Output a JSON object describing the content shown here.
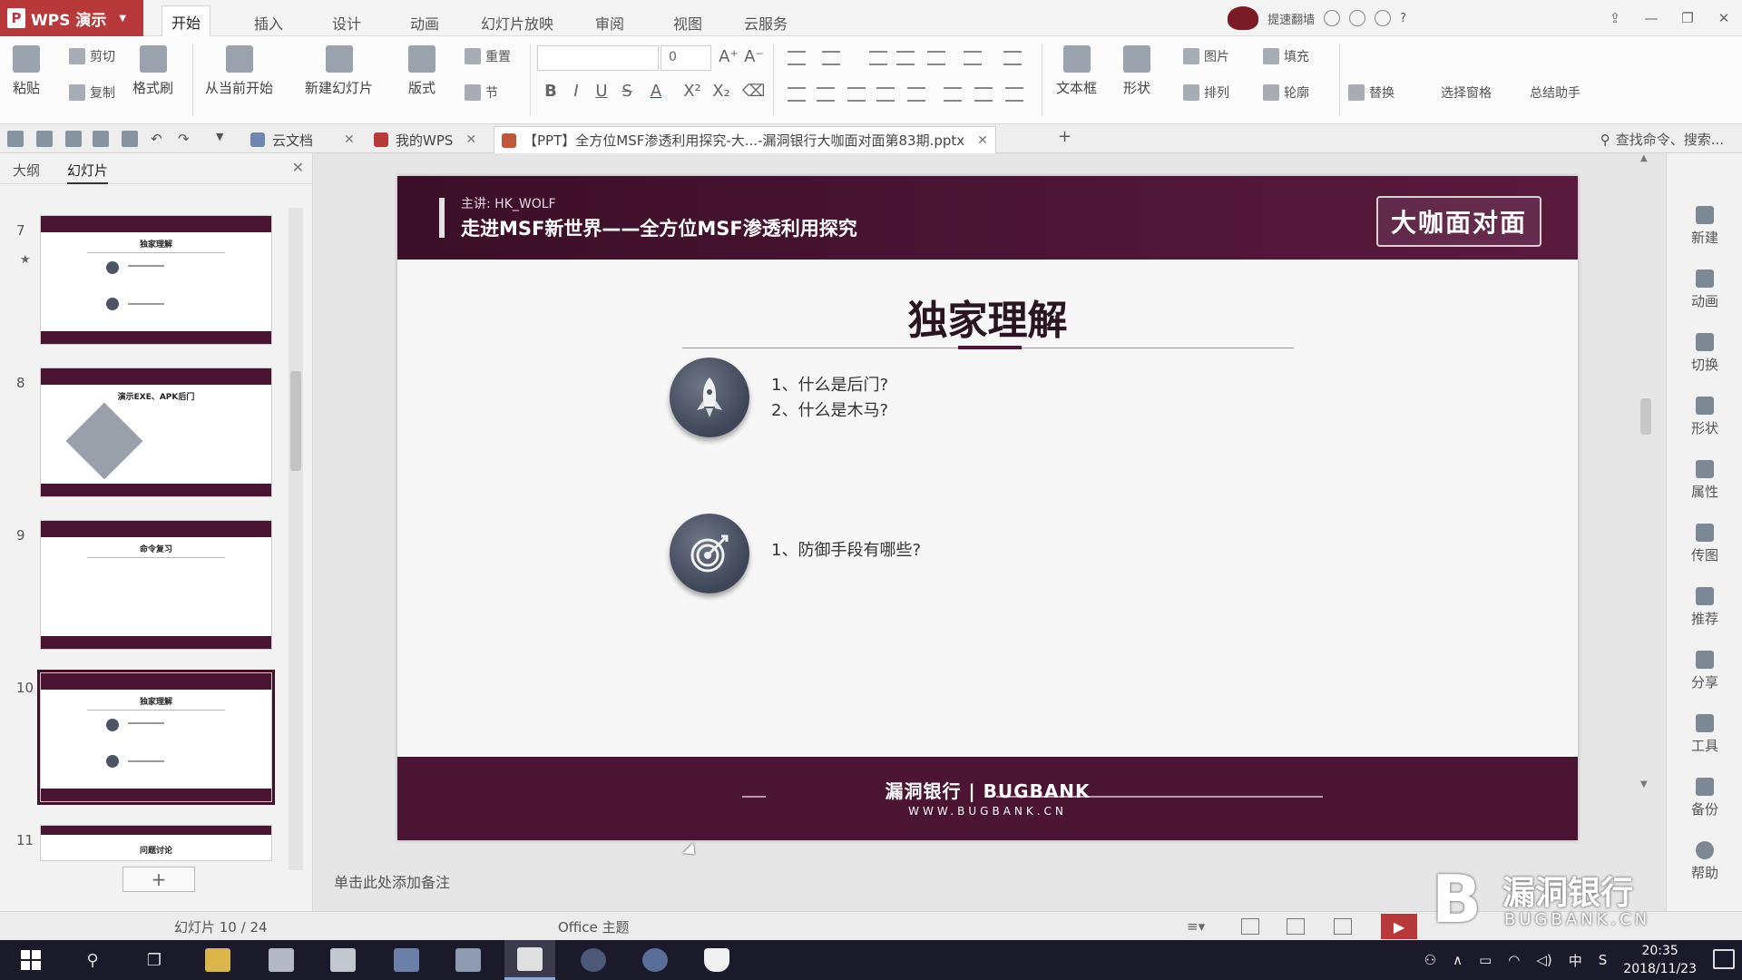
{
  "app": {
    "name": "WPS 演示",
    "menu_tabs": [
      "开始",
      "插入",
      "设计",
      "动画",
      "幻灯片放映",
      "审阅",
      "视图",
      "云服务"
    ],
    "active_tab": "开始",
    "user_label": "提速翻墙",
    "window_controls": [
      "minimize",
      "restore",
      "close"
    ]
  },
  "ribbon": {
    "paste": "粘贴",
    "cut": "剪切",
    "copy": "复制",
    "format_painter": "格式刷",
    "from_current": "从当前开始",
    "new_slide": "新建幻灯片",
    "layout": "版式",
    "reset": "重置",
    "section": "节",
    "font_size": "0",
    "bold": "B",
    "italic": "I",
    "underline": "U",
    "strike": "S",
    "font_color": "A",
    "superscript": "X²",
    "subscript": "X₂",
    "text_box": "文本框",
    "shape": "形状",
    "picture": "图片",
    "fill": "填充",
    "arrange": "排列",
    "outline": "轮廓",
    "replace": "替换",
    "select_pane": "选择窗格",
    "summary": "总结助手"
  },
  "doc_tabs": [
    {
      "label": "云文档",
      "active": false
    },
    {
      "label": "我的WPS",
      "active": false
    },
    {
      "label": "【PPT】全方位MSF渗透利用探究-大...-漏洞银行大咖面对面第83期.pptx",
      "active": true
    }
  ],
  "find_command": "查找命令、搜索...",
  "left_pane": {
    "tabs": [
      "大纲",
      "幻灯片"
    ],
    "active_tab": "幻灯片",
    "slides": [
      {
        "number": "7",
        "title": "独家理解"
      },
      {
        "number": "8",
        "title": "演示EXE、APK后门"
      },
      {
        "number": "9",
        "title": "命令复习"
      },
      {
        "number": "10",
        "title": "独家理解"
      },
      {
        "number": "11",
        "title": "问题讨论"
      }
    ],
    "selected_slide": "10",
    "add_slide": "+"
  },
  "slide": {
    "presenter": "主讲:  HK_WOLF",
    "deck_title": "走进MSF新世界——全方位MSF渗透利用探究",
    "brand_badge": "大咖面对面",
    "title": "独家理解",
    "section1": [
      "1、什么是后门?",
      "2、什么是木马?"
    ],
    "section2": [
      "1、防御手段有哪些?"
    ],
    "footer_brand": "漏洞银行 | BUGBANK",
    "footer_url": "WWW.BUGBANK.CN",
    "colors": {
      "header": "#4a1432",
      "accent": "#4d1536",
      "icon": "#4a5263"
    }
  },
  "notes_placeholder": "单击此处添加备注",
  "right_sidebar": [
    "新建",
    "动画",
    "切换",
    "形状",
    "属性",
    "传图",
    "推荐",
    "分享",
    "工具",
    "备份",
    "帮助"
  ],
  "status": {
    "slide_position": "幻灯片 10 / 24",
    "theme": "Office 主题"
  },
  "watermark": {
    "letter": "B",
    "text": "漏洞银行",
    "sub": "BUGBANK.CN"
  },
  "taskbar": {
    "time": "20:35",
    "date": "2018/11/23",
    "ime": "中"
  }
}
